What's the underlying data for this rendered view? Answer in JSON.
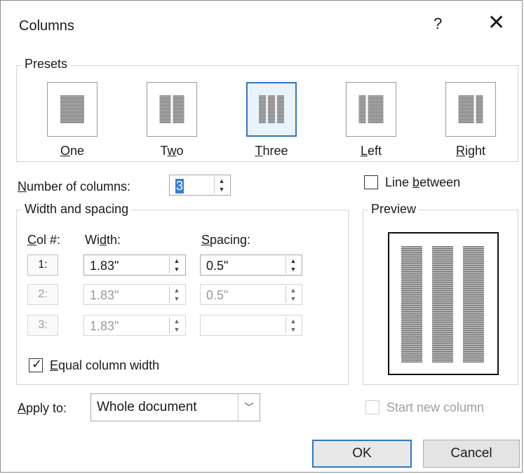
{
  "dialog": {
    "title": "Columns",
    "help": "?",
    "close": "✕"
  },
  "presets": {
    "group_label": "Presets",
    "items": [
      {
        "label_key": "O",
        "label_rest": "ne",
        "name": "One"
      },
      {
        "label_pre": "T",
        "label_key": "w",
        "label_rest": "o",
        "name": "Two"
      },
      {
        "label_key": "T",
        "label_rest": "hree",
        "name": "Three",
        "selected": true
      },
      {
        "label_key": "L",
        "label_rest": "eft",
        "name": "Left"
      },
      {
        "label_key": "R",
        "label_rest": "ight",
        "name": "Right"
      }
    ]
  },
  "number_of_columns": {
    "label_key": "N",
    "label_rest": "umber of columns:",
    "value": "3"
  },
  "line_between": {
    "label_pre": "Line ",
    "label_key": "b",
    "label_rest": "etween",
    "checked": false
  },
  "width_spacing": {
    "group_label": "Width and spacing",
    "col_header_key": "C",
    "col_header_rest": "ol #:",
    "width_header_pre": "Wi",
    "width_header_key": "d",
    "width_header_rest": "th:",
    "spacing_header_key": "S",
    "spacing_header_rest": "pacing:",
    "rows": [
      {
        "col": "1:",
        "width": "1.83\"",
        "spacing": "0.5\"",
        "enabled": true
      },
      {
        "col": "2:",
        "width": "1.83\"",
        "spacing": "0.5\"",
        "enabled": false
      },
      {
        "col": "3:",
        "width": "1.83\"",
        "spacing": "",
        "enabled": false
      }
    ],
    "equal_width": {
      "label_key": "E",
      "label_rest": "qual column width",
      "checked": true
    }
  },
  "preview": {
    "group_label": "Preview"
  },
  "apply_to": {
    "label_key": "A",
    "label_rest": "pply to:",
    "value": "Whole document"
  },
  "start_new_column": {
    "label": "Start new column",
    "checked": false,
    "enabled": false
  },
  "buttons": {
    "ok": "OK",
    "cancel": "Cancel"
  }
}
